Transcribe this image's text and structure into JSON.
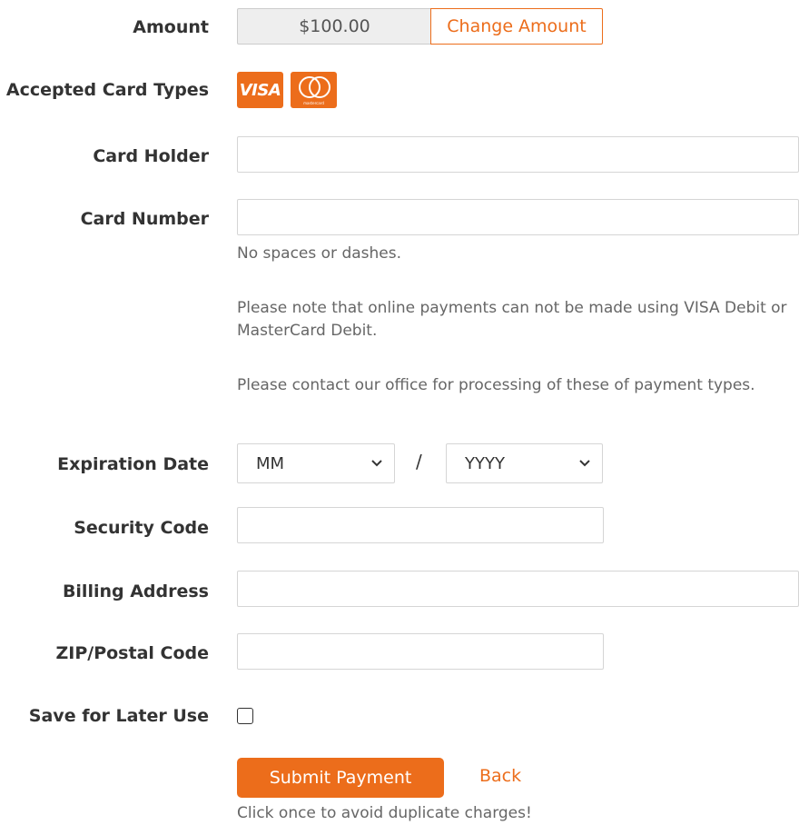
{
  "form": {
    "amount": {
      "label": "Amount",
      "value": "$100.00",
      "change_label": "Change Amount"
    },
    "card_types": {
      "label": "Accepted Card Types",
      "visa_text": "VISA",
      "mc_caption": "mastercard"
    },
    "card_holder": {
      "label": "Card Holder",
      "value": ""
    },
    "card_number": {
      "label": "Card Number",
      "value": "",
      "help": "No spaces or dashes.",
      "note1": "Please note that online payments can not be made using VISA Debit or MasterCard Debit.",
      "note2": "Please contact our office for processing of these of payment types."
    },
    "expiration": {
      "label": "Expiration Date",
      "month_selected": "MM",
      "separator": "/",
      "year_selected": "YYYY"
    },
    "security_code": {
      "label": "Security Code",
      "value": ""
    },
    "billing_address": {
      "label": "Billing Address",
      "value": ""
    },
    "zip": {
      "label": "ZIP/Postal Code",
      "value": ""
    },
    "save": {
      "label": "Save for Later Use",
      "checked": false
    },
    "submit_label": "Submit Payment",
    "back_label": "Back",
    "duplicate_note": "Click once to avoid duplicate charges!"
  },
  "icons": {
    "dropdown": "chevron-down-icon",
    "visa": "visa-icon",
    "mastercard": "mastercard-icon"
  },
  "colors": {
    "accent": "#ec6d1b",
    "label": "#333333",
    "help": "#666666",
    "border": "#d5d5d5"
  }
}
